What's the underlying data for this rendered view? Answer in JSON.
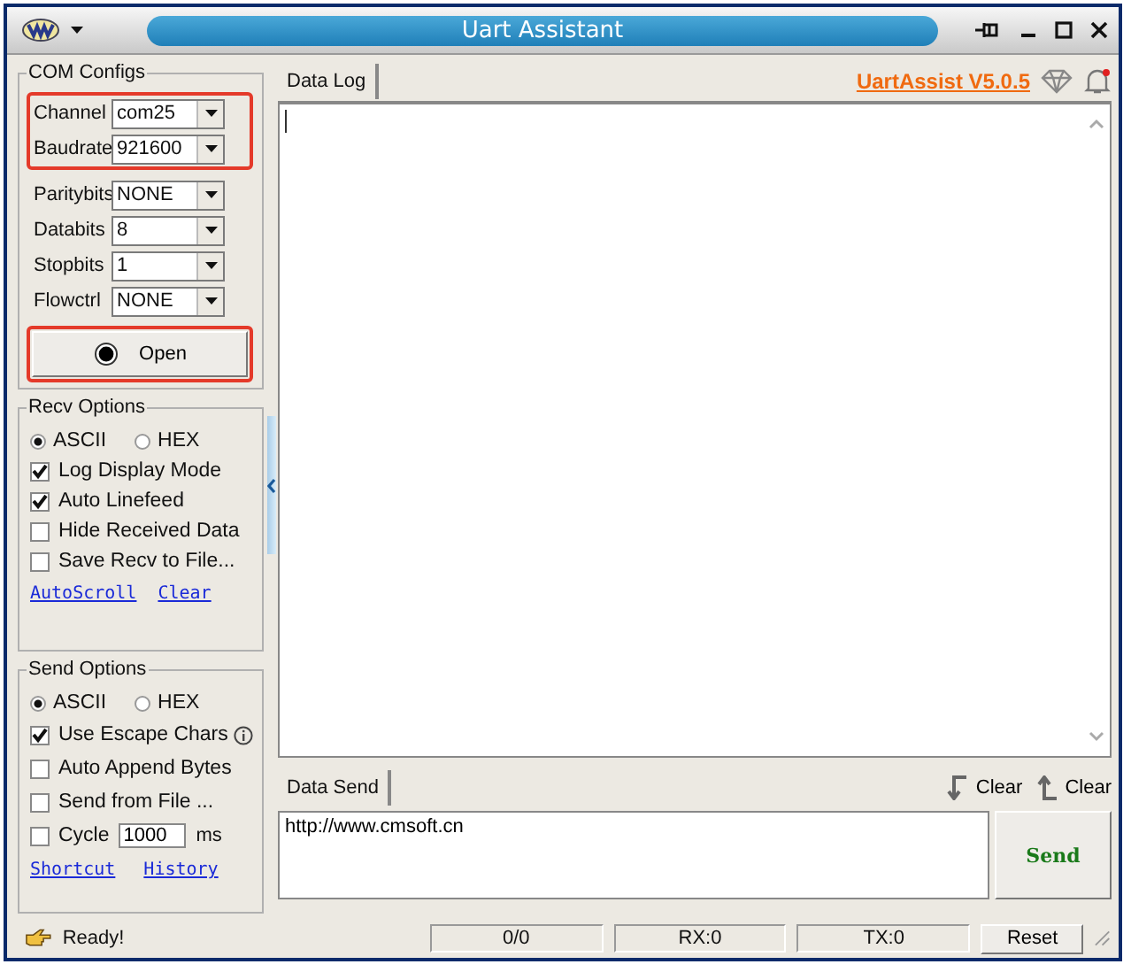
{
  "window": {
    "title": "Uart Assistant"
  },
  "com_configs": {
    "title": "COM Configs",
    "field_groups": [
      {
        "highlighted": true,
        "fields": [
          {
            "label": "Channel",
            "value": "com25"
          },
          {
            "label": "Baudrate",
            "value": "921600"
          }
        ]
      },
      {
        "highlighted": false,
        "fields": [
          {
            "label": "Paritybits",
            "value": "NONE"
          },
          {
            "label": "Databits",
            "value": "8"
          },
          {
            "label": "Stopbits",
            "value": "1"
          },
          {
            "label": "Flowctrl",
            "value": "NONE"
          }
        ]
      }
    ],
    "open_button": {
      "label": "Open",
      "highlighted": true
    }
  },
  "recv_options": {
    "title": "Recv Options",
    "modes": [
      {
        "label": "ASCII",
        "selected": true
      },
      {
        "label": "HEX",
        "selected": false
      }
    ],
    "checks": [
      {
        "label": "Log Display Mode",
        "checked": true
      },
      {
        "label": "Auto Linefeed",
        "checked": true
      },
      {
        "label": "Hide Received Data",
        "checked": false
      },
      {
        "label": "Save Recv to File...",
        "checked": false
      }
    ],
    "links": [
      "AutoScroll",
      "Clear"
    ]
  },
  "send_options": {
    "title": "Send Options",
    "modes": [
      {
        "label": "ASCII",
        "selected": true
      },
      {
        "label": "HEX",
        "selected": false
      }
    ],
    "checks": [
      {
        "kind": "info",
        "label": "Use Escape Chars",
        "checked": true
      },
      {
        "kind": "plain",
        "label": "Auto Append Bytes",
        "checked": false
      },
      {
        "kind": "plain",
        "label": "Send from File ...",
        "checked": false
      },
      {
        "kind": "cycle",
        "label": "Cycle",
        "checked": false,
        "value": "1000",
        "unit": "ms"
      }
    ],
    "links": [
      "Shortcut",
      "History"
    ]
  },
  "data_log": {
    "tab": "Data Log",
    "version_link": "UartAssist V5.0.5"
  },
  "data_send": {
    "tab": "Data Send",
    "clear_buttons": [
      "Clear",
      "Clear"
    ],
    "value": "http://www.cmsoft.cn",
    "send_button": "Send"
  },
  "status_bar": {
    "message": "Ready!",
    "counter": "0/0",
    "rx": "RX:0",
    "tx": "TX:0",
    "reset": "Reset"
  }
}
